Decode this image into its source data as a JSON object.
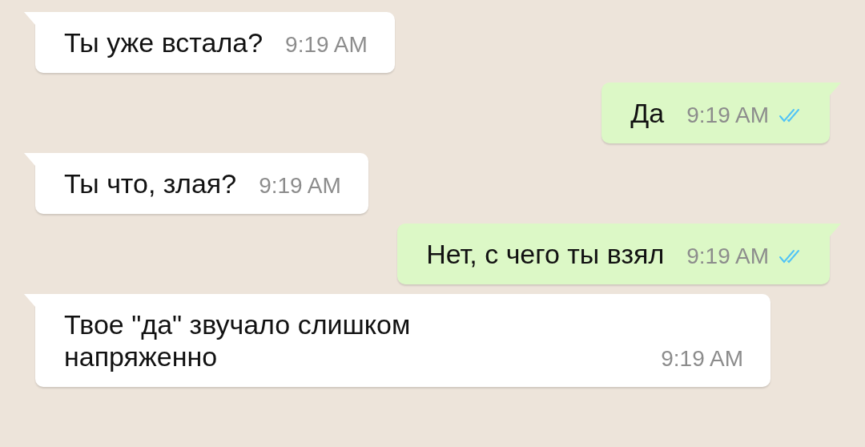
{
  "messages": [
    {
      "kind": "incoming",
      "text": "Ты уже встала?",
      "time": "9:19 AM"
    },
    {
      "kind": "outgoing",
      "text": "Да",
      "time": "9:19 AM",
      "read": true
    },
    {
      "kind": "incoming",
      "text": "Ты что, злая?",
      "time": "9:19 AM"
    },
    {
      "kind": "outgoing",
      "text": "Нет, с чего ты взял",
      "time": "9:19 AM",
      "read": true
    },
    {
      "kind": "incoming",
      "text": "Твое \"да\" звучало слишком\nнапряженно",
      "time": "9:19 AM"
    }
  ]
}
